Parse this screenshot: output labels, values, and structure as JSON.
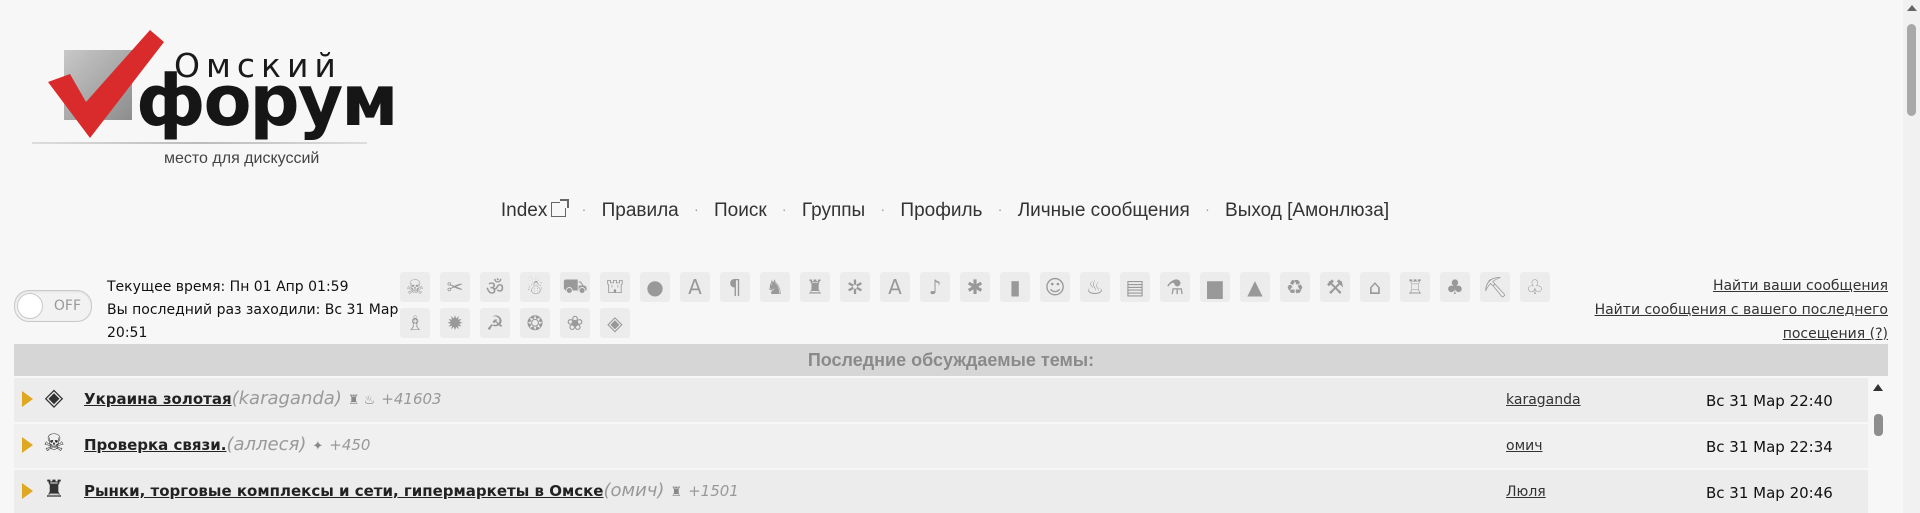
{
  "colors": {
    "logo_red": "#d92b2b",
    "accent_bullet": "#e0a820",
    "header_bg": "#d6d6d6",
    "row_bg_a": "#ececec",
    "row_bg_b": "#f0f0f0"
  },
  "logo": {
    "small_text": "Омский",
    "big_text": "форум",
    "tagline": "место для дискуссий"
  },
  "nav": {
    "items": [
      {
        "label": "Index",
        "icon": "external-link-icon"
      },
      {
        "label": "Правила"
      },
      {
        "label": "Поиск"
      },
      {
        "label": "Группы"
      },
      {
        "label": "Профиль"
      },
      {
        "label": "Личные сообщения"
      },
      {
        "label": "Выход [Амонлюза]"
      }
    ],
    "separator": "·"
  },
  "toggle": {
    "label": "OFF",
    "state": "off"
  },
  "time_info": {
    "current_time": "Текущее время: Пн 01 Апр 01:59",
    "last_visit": "Вы последний раз заходили: Вс 31 Мар 20:51"
  },
  "smiley_icons": [
    {
      "name": "skull-icon",
      "glyph": "☠"
    },
    {
      "name": "scissors-icon",
      "glyph": "✂"
    },
    {
      "name": "om-icon",
      "glyph": "ॐ"
    },
    {
      "name": "imp-icon",
      "glyph": "☃"
    },
    {
      "name": "car-icon",
      "glyph": "⛟"
    },
    {
      "name": "mushroom-icon",
      "glyph": "⛫"
    },
    {
      "name": "bomb-icon",
      "glyph": "●"
    },
    {
      "name": "letter-a-ornate-icon",
      "glyph": "A"
    },
    {
      "name": "pilcrow-icon",
      "glyph": "¶"
    },
    {
      "name": "ribbon-icon",
      "glyph": "♞"
    },
    {
      "name": "castle-icon",
      "glyph": "♜"
    },
    {
      "name": "pinwheel-icon",
      "glyph": "✲"
    },
    {
      "name": "letter-a-icon",
      "glyph": "A"
    },
    {
      "name": "music-note-icon",
      "glyph": "♪"
    },
    {
      "name": "person-icon",
      "glyph": "✱"
    },
    {
      "name": "can-icon",
      "glyph": "▮"
    },
    {
      "name": "smiley-icon",
      "glyph": "☺"
    },
    {
      "name": "steam-icon",
      "glyph": "♨"
    },
    {
      "name": "paper-icon",
      "glyph": "▤"
    },
    {
      "name": "chemistry-icon",
      "glyph": "⚗"
    },
    {
      "name": "bag-icon",
      "glyph": "▆"
    },
    {
      "name": "landscape-icon",
      "glyph": "▲"
    },
    {
      "name": "recycle-icon",
      "glyph": "♻"
    },
    {
      "name": "hammer-icon",
      "glyph": "⚒"
    },
    {
      "name": "house-icon",
      "glyph": "⌂"
    },
    {
      "name": "factory-icon",
      "glyph": "♖"
    },
    {
      "name": "acorn-icon",
      "glyph": "♣"
    },
    {
      "name": "pickaxe-icon",
      "glyph": "⛏"
    },
    {
      "name": "clover-icon",
      "glyph": "♧"
    },
    {
      "name": "tower-icon",
      "glyph": "♗"
    },
    {
      "name": "fire-icon",
      "glyph": "✹"
    },
    {
      "name": "hammer-sickle-icon",
      "glyph": "☭"
    },
    {
      "name": "ear-icon",
      "glyph": "❂"
    },
    {
      "name": "flower-icon",
      "glyph": "❀"
    },
    {
      "name": "cube-icon",
      "glyph": "◈"
    }
  ],
  "right_links": {
    "find_yours": "Найти ваши сообщения",
    "find_since_visit": "Найти сообщения с вашего последнего посещения (?)"
  },
  "section_header": "Последние обсуждаемые темы:",
  "topics": [
    {
      "icon": "cube-icon",
      "glyph": "◈",
      "title": "Украина золотая",
      "starter": "(karaganda)",
      "badges": "♜ ♨",
      "count": "+41603",
      "last_user": "karaganda",
      "date": "Вс 31 Мар 22:40"
    },
    {
      "icon": "skull-icon",
      "glyph": "☠",
      "title": "Проверка связи.",
      "starter": "(аллеся)",
      "badges": "✦",
      "count": "+450",
      "last_user": "омич",
      "date": "Вс 31 Мар 22:34"
    },
    {
      "icon": "castle-icon",
      "glyph": "♜",
      "title": "Рынки, торговые комплексы и сети, гипермаркеты в Омске",
      "starter": "(омич)",
      "badges": "♜",
      "count": "+1501",
      "last_user": "Люля",
      "date": "Вс 31 Мар 20:46"
    }
  ]
}
